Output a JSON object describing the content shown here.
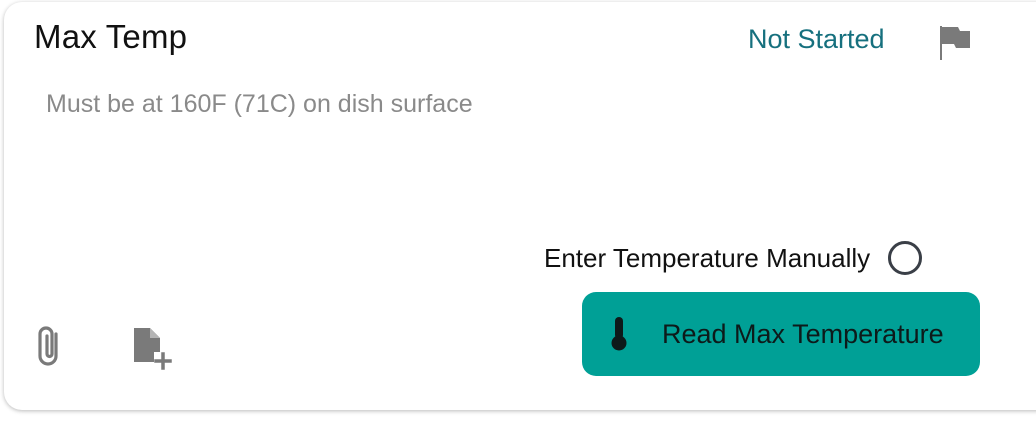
{
  "card": {
    "title": "Max Temp",
    "status": "Not Started",
    "description": "Must be at 160F (71C) on dish surface",
    "manual_entry_label": "Enter Temperature Manually",
    "manual_entry_checked": false,
    "read_button_label": "Read Max Temperature"
  },
  "icons": {
    "flag": "flag-icon",
    "attachment": "paperclip-icon",
    "add_note": "add-note-icon",
    "thermometer": "thermometer-icon"
  },
  "colors": {
    "status_text": "#16707e",
    "button_bg": "#00a096",
    "icon_gray": "#7a7a7a",
    "description_text": "#8a8a8a"
  }
}
